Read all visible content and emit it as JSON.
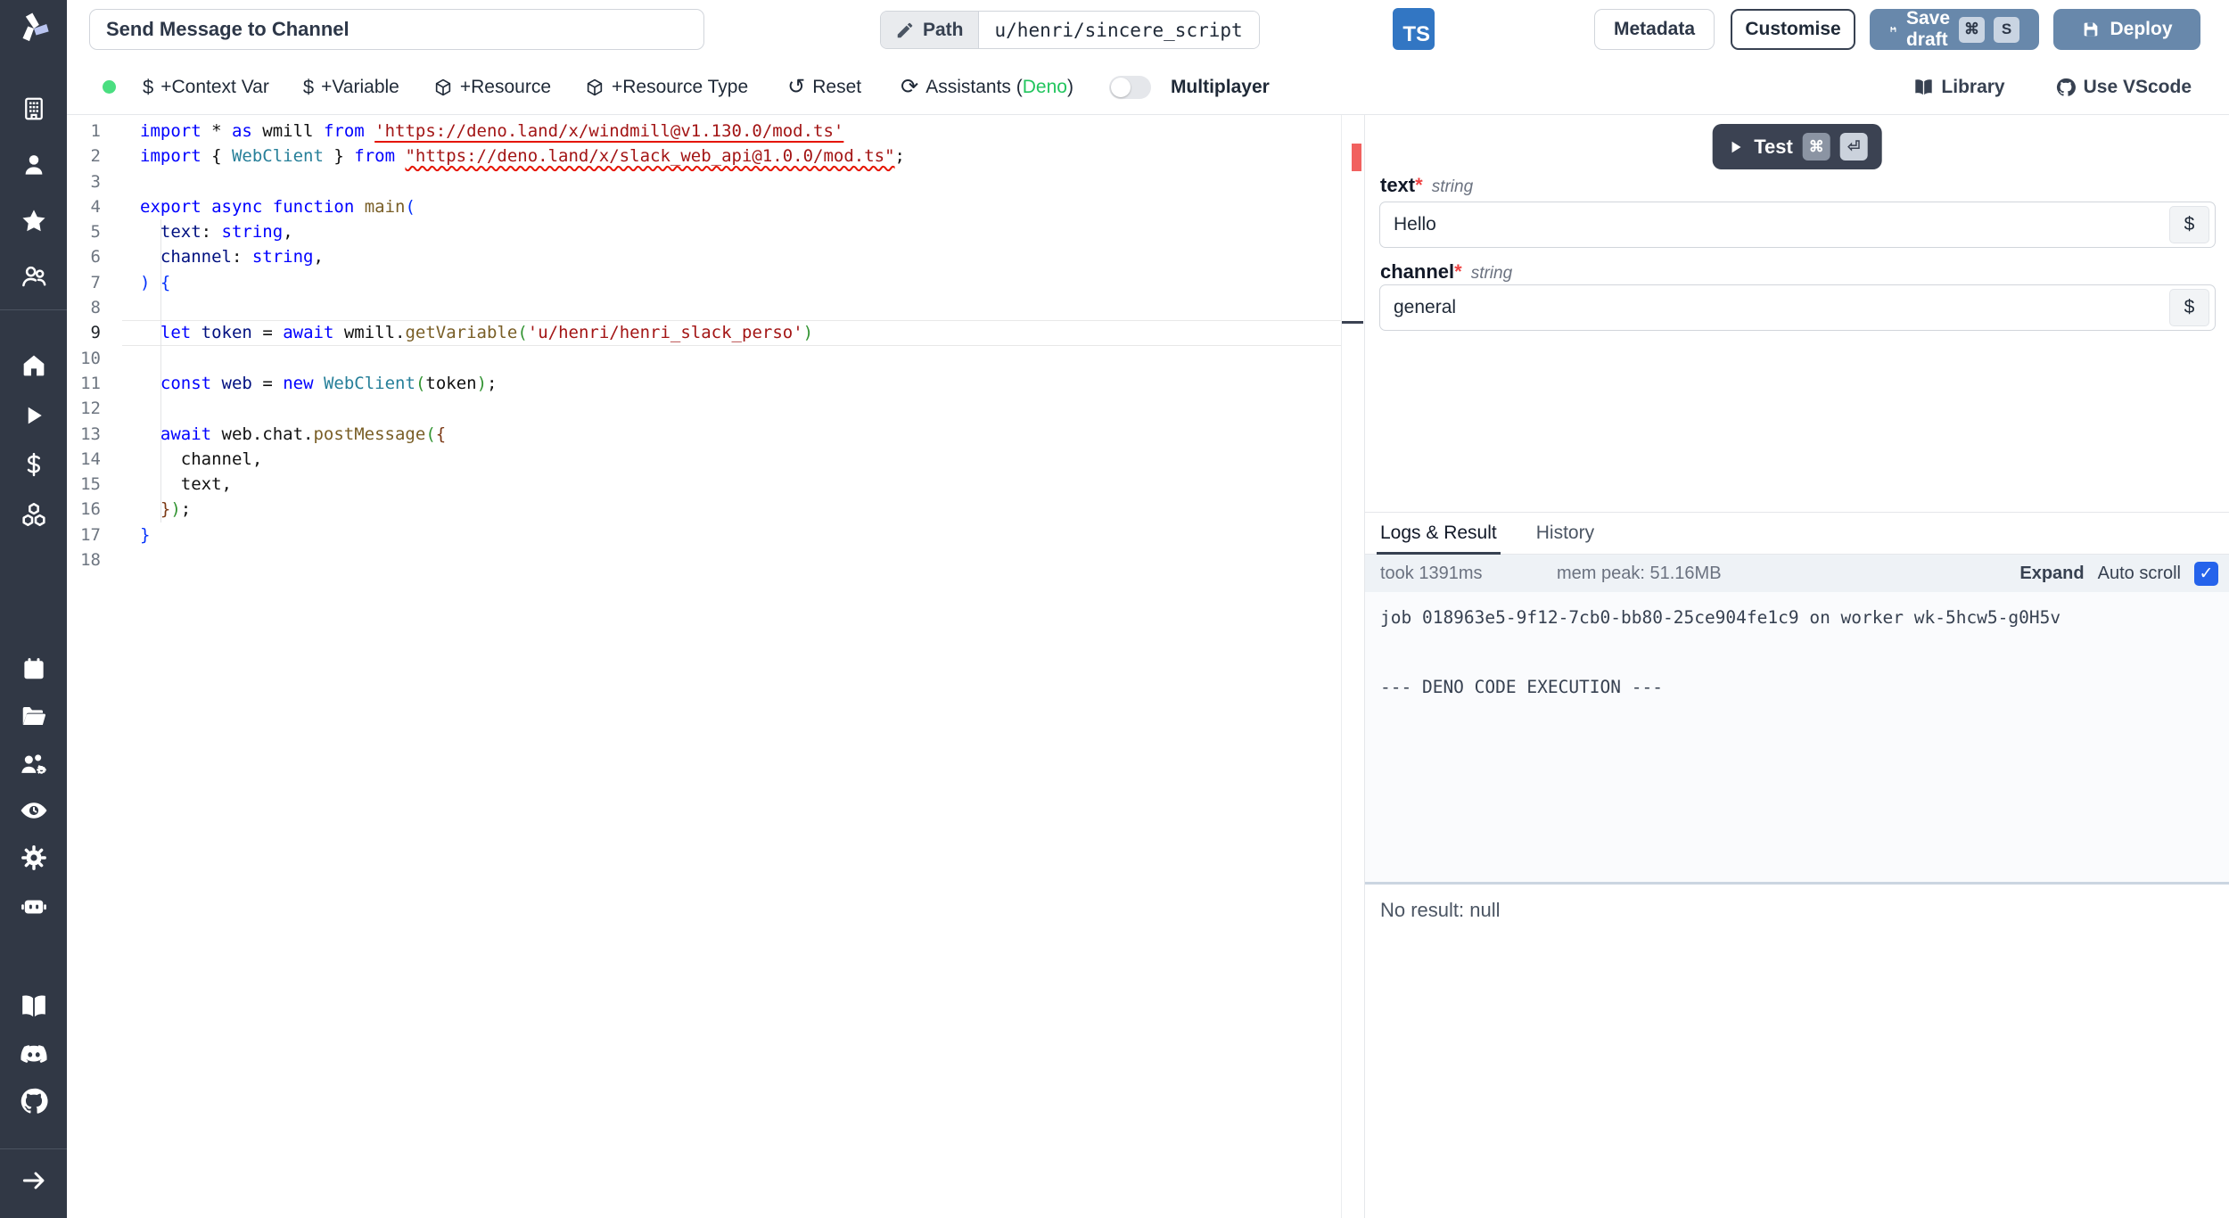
{
  "app": {
    "name": "Windmill"
  },
  "topbar": {
    "title_value": "Send Message to Channel",
    "path_label": "Path",
    "path_value": "u/henri/sincere_script",
    "lang_badge": "TS",
    "metadata_label": "Metadata",
    "customise_label": "Customise",
    "save_draft_label": "Save draft",
    "save_draft_keys": {
      "k1": "⌘",
      "k2": "S"
    },
    "deploy_label": "Deploy"
  },
  "toolbar": {
    "context_var": "+Context Var",
    "variable": "+Variable",
    "resource": "+Resource",
    "resource_type": "+Resource Type",
    "reset": "Reset",
    "assistants_prefix": "Assistants (",
    "assistants_lang": "Deno",
    "assistants_suffix": ")",
    "multiplayer": "Multiplayer",
    "library": "Library",
    "vscode": "Use VScode",
    "dollar_glyph": "$",
    "reset_glyph": "↺",
    "assistants_glyph": "⟳"
  },
  "sidebar": {
    "icons": [
      "windmill-logo",
      "building-icon",
      "user-icon",
      "star-icon",
      "users-icon",
      "home-icon",
      "play-icon",
      "dollar-icon",
      "cubes-icon",
      "calendar-icon",
      "folder-open-icon",
      "users-gear-icon",
      "eye-icon",
      "gear-icon",
      "robot-icon",
      "book-icon",
      "discord-icon",
      "github-icon",
      "arrow-right-icon"
    ]
  },
  "editor": {
    "line_count": 18,
    "active_line": 9,
    "lines": [
      [
        [
          "import",
          "k"
        ],
        [
          " * ",
          "d"
        ],
        [
          "as",
          "k"
        ],
        [
          " wmill ",
          "d"
        ],
        [
          "from",
          "k"
        ],
        [
          " ",
          "d"
        ],
        [
          "'https://deno.land/x/windmill@v1.130.0/mod.ts'",
          "s su"
        ]
      ],
      [
        [
          "import",
          "k"
        ],
        [
          " { ",
          "d"
        ],
        [
          "WebClient",
          "t"
        ],
        [
          " } ",
          "d"
        ],
        [
          "from",
          "k"
        ],
        [
          " ",
          "d"
        ],
        [
          "\"https://deno.land/x/slack_web_api@1.0.0/mod.ts\"",
          "s sw"
        ],
        [
          ";",
          "d"
        ]
      ],
      [],
      [
        [
          "export",
          "k"
        ],
        [
          " ",
          "d"
        ],
        [
          "async",
          "k"
        ],
        [
          " ",
          "d"
        ],
        [
          "function",
          "k"
        ],
        [
          " ",
          "d"
        ],
        [
          "main",
          "f"
        ],
        [
          "(",
          "b1"
        ]
      ],
      [
        [
          "  ",
          "d"
        ],
        [
          "text",
          "v"
        ],
        [
          ": ",
          "d"
        ],
        [
          "string",
          "k"
        ],
        [
          ",",
          "d"
        ]
      ],
      [
        [
          "  ",
          "d"
        ],
        [
          "channel",
          "v"
        ],
        [
          ": ",
          "d"
        ],
        [
          "string",
          "k"
        ],
        [
          ",",
          "d"
        ]
      ],
      [
        [
          ") {",
          "b1"
        ]
      ],
      [],
      [
        [
          "  ",
          "d"
        ],
        [
          "let",
          "k"
        ],
        [
          " ",
          "d"
        ],
        [
          "token",
          "v"
        ],
        [
          " = ",
          "d"
        ],
        [
          "await",
          "k"
        ],
        [
          " wmill.",
          "d"
        ],
        [
          "getVariable",
          "f"
        ],
        [
          "(",
          "b2"
        ],
        [
          "'u/henri/henri_slack_perso'",
          "s"
        ],
        [
          ")",
          "b2"
        ]
      ],
      [],
      [
        [
          "  ",
          "d"
        ],
        [
          "const",
          "k"
        ],
        [
          " ",
          "d"
        ],
        [
          "web",
          "v"
        ],
        [
          " = ",
          "d"
        ],
        [
          "new",
          "k"
        ],
        [
          " ",
          "d"
        ],
        [
          "WebClient",
          "t"
        ],
        [
          "(",
          "b2"
        ],
        [
          "token",
          "d"
        ],
        [
          ")",
          "b2"
        ],
        [
          ";",
          "d"
        ]
      ],
      [],
      [
        [
          "  ",
          "d"
        ],
        [
          "await",
          "k"
        ],
        [
          " web.chat.",
          "d"
        ],
        [
          "postMessage",
          "f"
        ],
        [
          "(",
          "b2"
        ],
        [
          "{",
          "b3"
        ]
      ],
      [
        [
          "    channel,",
          "d"
        ]
      ],
      [
        [
          "    text,",
          "d"
        ]
      ],
      [
        [
          "  ",
          "d"
        ],
        [
          "}",
          "b3"
        ],
        [
          ")",
          "b2"
        ],
        [
          ";",
          "d"
        ]
      ],
      [
        [
          "}",
          "b1"
        ]
      ],
      []
    ]
  },
  "run_panel": {
    "test_label": "Test",
    "test_keys": {
      "k1": "⌘",
      "k2": "⏎"
    },
    "fields": [
      {
        "name": "text",
        "required": "*",
        "type": "string",
        "value": "Hello",
        "suffix": "$"
      },
      {
        "name": "channel",
        "required": "*",
        "type": "string",
        "value": "general",
        "suffix": "$"
      }
    ],
    "tabs": {
      "logs": "Logs & Result",
      "history": "History"
    },
    "stats": {
      "took": "took 1391ms",
      "mem": "mem peak: 51.16MB",
      "expand": "Expand",
      "autoscroll": "Auto scroll",
      "autoscroll_check": "✓"
    },
    "logs": {
      "line1": "job 018963e5-9f12-7cb0-bb80-25ce904fe1c9 on worker wk-5hcw5-g0H5v",
      "line2": "--- DENO CODE EXECUTION ---"
    },
    "result": "No result: null"
  },
  "colors": {
    "sidebar_bg": "#313845",
    "accent_button": "#6888ab",
    "ts_badge": "#3276c3",
    "status_dot": "#4ade80",
    "assistants_green": "#22c55e",
    "checkbox_blue": "#2563eb",
    "error_marker": "#f1615f"
  }
}
